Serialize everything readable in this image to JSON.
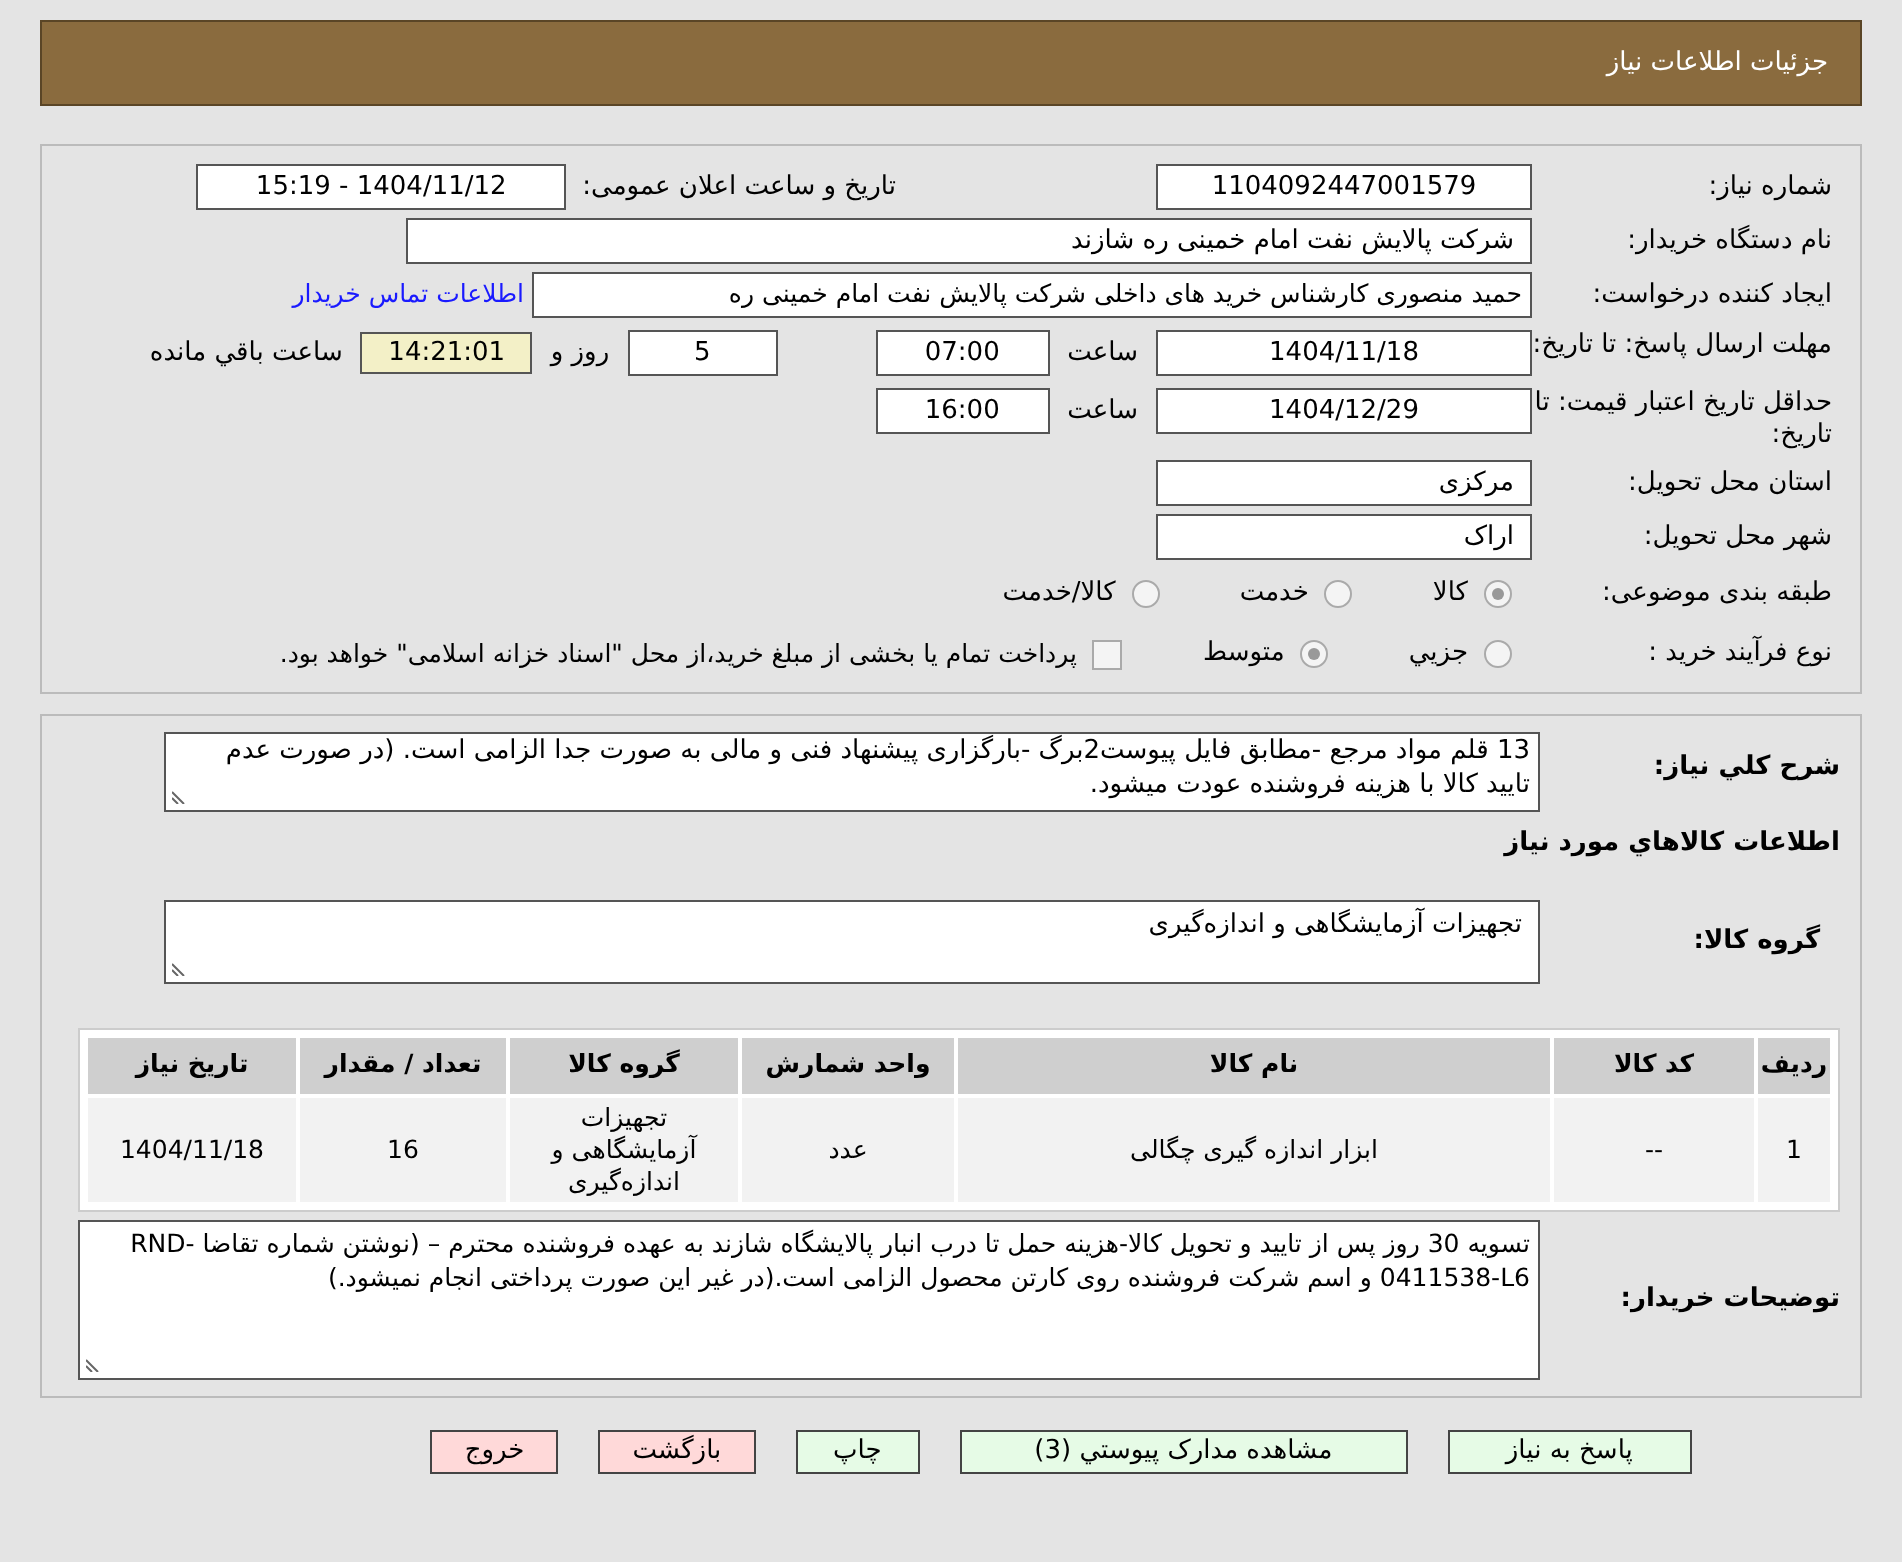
{
  "header": {
    "title": "جزئیات اطلاعات نیاز"
  },
  "need_number": {
    "label": "شماره نیاز:",
    "value": "1104092447001579"
  },
  "announce": {
    "label": "تاریخ و ساعت اعلان عمومی:",
    "value": "1404/11/12 - 15:19"
  },
  "buyer_org": {
    "label": "نام دستگاه خریدار:",
    "value": "شرکت پالایش نفت امام خمینی  ره  شازند"
  },
  "creator": {
    "label": "ایجاد کننده درخواست:",
    "value": "حمید منصوری کارشناس خرید های داخلی  شرکت پالایش نفت امام خمینی  ره",
    "link": "اطلاعات تماس خریدار"
  },
  "deadline": {
    "label": "مهلت ارسال پاسخ: تا تاریخ:",
    "date": "1404/11/18",
    "time_label": "ساعت",
    "time": "07:00",
    "days": "5",
    "days_label": "روز و",
    "remaining": "14:21:01",
    "remaining_label": "ساعت باقي مانده"
  },
  "validity": {
    "label": "حداقل تاریخ اعتبار قیمت: تا تاریخ:",
    "date": "1404/12/29",
    "time_label": "ساعت",
    "time": "16:00"
  },
  "province": {
    "label": "استان محل تحویل:",
    "value": "مرکزی"
  },
  "city": {
    "label": "شهر محل تحویل:",
    "value": "اراک"
  },
  "category": {
    "label": "طبقه بندی موضوعی:",
    "options": [
      {
        "label": "کالا",
        "selected": true
      },
      {
        "label": "خدمت",
        "selected": false
      },
      {
        "label": "کالا/خدمت",
        "selected": false
      }
    ]
  },
  "process": {
    "label": "نوع فرآیند خرید :",
    "options": [
      {
        "label": "جزيي",
        "selected": false
      },
      {
        "label": "متوسط",
        "selected": true
      }
    ],
    "treasury": {
      "checked": false,
      "text": "پرداخت تمام یا بخشی از مبلغ خرید،از محل \"اسناد خزانه اسلامی\" خواهد بود."
    }
  },
  "description": {
    "label": "شرح کلي نیاز:",
    "value": "13 قلم مواد مرجع -مطابق فایل پیوست2برگ -بارگزاری پیشنهاد فنی و مالی به صورت جدا الزامی است. (در صورت عدم تایید کالا با هزینه فروشنده عودت میشود."
  },
  "goods_title": "اطلاعات کالاهاي مورد نیاز",
  "goods_group": {
    "label": "گروه کالا:",
    "value": "تجهیزات آزمایشگاهی و اندازه‌گیری"
  },
  "table": {
    "columns": [
      "ردیف",
      "کد کالا",
      "نام کالا",
      "واحد شمارش",
      "گروه کالا",
      "تعداد / مقدار",
      "تاریخ نیاز"
    ],
    "rows": [
      [
        "1",
        "--",
        "ابزار اندازه گیری چگالی",
        "عدد",
        "تجهیزات آزمایشگاهی و اندازه‌گیری",
        "16",
        "1404/11/18"
      ]
    ]
  },
  "buyer_notes": {
    "label": "توضیحات خریدار:",
    "value": "تسویه 30 روز پس از تایید و تحویل کالا-هزینه حمل تا درب انبار پالایشگاه شازند به عهده فروشنده محترم – (نوشتن شماره تقاضا RND-0411538-L6 و اسم شرکت فروشنده  روی کارتن محصول الزامی است.(در غیر این صورت پرداختی انجام نمیشود.)"
  },
  "buttons": [
    {
      "label": "پاسخ به نیاز",
      "kind": "normal"
    },
    {
      "label": "مشاهده مدارک پیوستي (3)",
      "kind": "normal"
    },
    {
      "label": "چاپ",
      "kind": "normal"
    },
    {
      "label": "بازگشت",
      "kind": "exit"
    },
    {
      "label": "خروج",
      "kind": "exit"
    }
  ]
}
